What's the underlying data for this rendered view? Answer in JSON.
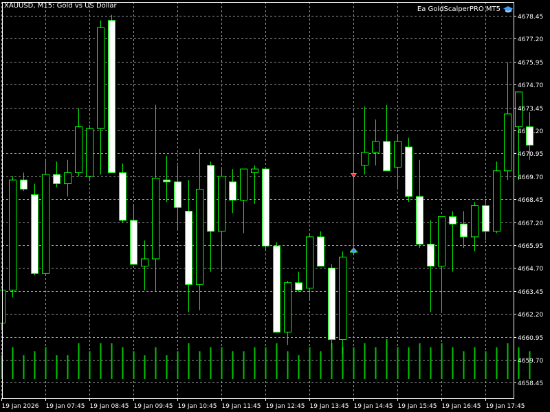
{
  "window": {
    "title": "XAUUSD, M15:  Gold vs US Dollar",
    "ea_label": "Ea GoldScalperPRO MT5",
    "ea_icon": "graduation-cap-icon"
  },
  "colors": {
    "background": "#000000",
    "grid": "#9a9a9a",
    "bull_fill": "#000000",
    "bear_fill": "#ffffff",
    "wick": "#00ff00",
    "volume": "#00c800",
    "axis_text": "#ffffff",
    "sell_marker": "#ff3030",
    "buy_marker": "#3aa0ff"
  },
  "chart_data": {
    "type": "candlestick",
    "y_axis": {
      "min": 4657.6,
      "max": 4679.2,
      "ticks": [
        "4678.45",
        "4677.20",
        "4675.95",
        "4674.70",
        "4673.45",
        "4672.20",
        "4670.95",
        "4669.70",
        "4668.45",
        "4667.20",
        "4665.95",
        "4664.70",
        "4663.45",
        "4662.20",
        "4660.95",
        "4659.70",
        "4658.45"
      ]
    },
    "x_axis": {
      "labels": [
        "19 Jan 2026",
        "19 Jan 07:45",
        "19 Jan 08:45",
        "19 Jan 09:45",
        "19 Jan 10:45",
        "19 Jan 11:45",
        "19 Jan 12:45",
        "19 Jan 13:45",
        "19 Jan 14:45",
        "19 Jan 15:45",
        "19 Jan 16:45",
        "19 Jan 17:45"
      ],
      "label_every": 4
    },
    "grid": true,
    "candles": [
      {
        "o": 4661.7,
        "h": 4663.5,
        "l": 4661.3,
        "c": 4663.5
      },
      {
        "o": 4663.5,
        "h": 4669.7,
        "l": 4663.1,
        "c": 4669.5
      },
      {
        "o": 4669.5,
        "h": 4669.9,
        "l": 4668.9,
        "c": 4669.0
      },
      {
        "o": 4668.7,
        "h": 4669.3,
        "l": 4664.3,
        "c": 4664.4
      },
      {
        "o": 4664.4,
        "h": 4670.6,
        "l": 4664.3,
        "c": 4669.8
      },
      {
        "o": 4669.8,
        "h": 4670.5,
        "l": 4669.1,
        "c": 4669.3
      },
      {
        "o": 4669.3,
        "h": 4670.6,
        "l": 4668.6,
        "c": 4669.9
      },
      {
        "o": 4669.9,
        "h": 4673.4,
        "l": 4669.7,
        "c": 4672.4
      },
      {
        "o": 4669.7,
        "h": 4672.5,
        "l": 4669.5,
        "c": 4672.3
      },
      {
        "o": 4672.3,
        "h": 4678.2,
        "l": 4669.8,
        "c": 4677.8
      },
      {
        "o": 4678.2,
        "h": 4678.5,
        "l": 4669.9,
        "c": 4669.9
      },
      {
        "o": 4669.9,
        "h": 4670.4,
        "l": 4667.2,
        "c": 4667.3
      },
      {
        "o": 4667.3,
        "h": 4668.2,
        "l": 4664.9,
        "c": 4664.9
      },
      {
        "o": 4664.8,
        "h": 4666.2,
        "l": 4663.5,
        "c": 4665.2
      },
      {
        "o": 4665.2,
        "h": 4673.6,
        "l": 4663.4,
        "c": 4669.6
      },
      {
        "o": 4669.5,
        "h": 4670.8,
        "l": 4668.3,
        "c": 4669.4
      },
      {
        "o": 4669.4,
        "h": 4670.3,
        "l": 4666.8,
        "c": 4668.0
      },
      {
        "o": 4667.8,
        "h": 4669.5,
        "l": 4662.3,
        "c": 4663.8
      },
      {
        "o": 4663.8,
        "h": 4671.2,
        "l": 4662.4,
        "c": 4669.0
      },
      {
        "o": 4670.3,
        "h": 4670.5,
        "l": 4664.5,
        "c": 4666.7
      },
      {
        "o": 4666.7,
        "h": 4670.1,
        "l": 4664.5,
        "c": 4669.7
      },
      {
        "o": 4669.4,
        "h": 4670.1,
        "l": 4667.7,
        "c": 4668.4
      },
      {
        "o": 4668.4,
        "h": 4669.7,
        "l": 4666.6,
        "c": 4670.1
      },
      {
        "o": 4669.9,
        "h": 4670.3,
        "l": 4668.2,
        "c": 4670.1
      },
      {
        "o": 4670.1,
        "h": 4670.1,
        "l": 4665.7,
        "c": 4665.9
      },
      {
        "o": 4665.9,
        "h": 4666.1,
        "l": 4661.6,
        "c": 4661.2
      },
      {
        "o": 4661.2,
        "h": 4664.0,
        "l": 4660.5,
        "c": 4663.9
      },
      {
        "o": 4663.9,
        "h": 4664.5,
        "l": 4663.4,
        "c": 4663.5
      },
      {
        "o": 4663.6,
        "h": 4666.6,
        "l": 4663.0,
        "c": 4666.4
      },
      {
        "o": 4666.4,
        "h": 4666.7,
        "l": 4664.8,
        "c": 4664.8
      },
      {
        "o": 4664.7,
        "h": 4664.9,
        "l": 4660.3,
        "c": 4660.8
      },
      {
        "o": 4660.8,
        "h": 4665.6,
        "l": 4660.0,
        "c": 4665.3
      },
      {
        "o": 4665.6,
        "h": 4672.8,
        "l": 4665.5,
        "c": 4665.6
      },
      {
        "o": 4670.3,
        "h": 4673.5,
        "l": 4669.8,
        "c": 4671.0
      },
      {
        "o": 4671.0,
        "h": 4672.8,
        "l": 4670.3,
        "c": 4671.6
      },
      {
        "o": 4671.6,
        "h": 4673.6,
        "l": 4670.3,
        "c": 4670.0
      },
      {
        "o": 4670.2,
        "h": 4672.0,
        "l": 4669.0,
        "c": 4671.6
      },
      {
        "o": 4671.3,
        "h": 4671.8,
        "l": 4668.3,
        "c": 4668.6
      },
      {
        "o": 4668.6,
        "h": 4670.6,
        "l": 4665.8,
        "c": 4666.0
      },
      {
        "o": 4666.0,
        "h": 4667.3,
        "l": 4662.3,
        "c": 4664.8
      },
      {
        "o": 4664.8,
        "h": 4666.5,
        "l": 4662.3,
        "c": 4667.5
      },
      {
        "o": 4667.5,
        "h": 4667.8,
        "l": 4664.5,
        "c": 4667.1
      },
      {
        "o": 4667.1,
        "h": 4667.8,
        "l": 4665.8,
        "c": 4666.4
      },
      {
        "o": 4666.4,
        "h": 4668.3,
        "l": 4665.6,
        "c": 4668.1
      },
      {
        "o": 4668.1,
        "h": 4668.3,
        "l": 4666.2,
        "c": 4666.7
      },
      {
        "o": 4666.7,
        "h": 4670.5,
        "l": 4666.6,
        "c": 4670.0
      },
      {
        "o": 4670.0,
        "h": 4675.9,
        "l": 4669.5,
        "c": 4673.1
      },
      {
        "o": 4672.4,
        "h": 4674.3,
        "l": 4669.5,
        "c": 4674.3
      },
      {
        "o": 4672.4,
        "h": 4673.2,
        "l": 4670.6,
        "c": 4671.4
      }
    ],
    "volumes": [
      0.6,
      0.8,
      0.6,
      0.7,
      0.8,
      0.6,
      0.6,
      0.9,
      0.7,
      0.9,
      0.9,
      0.8,
      0.7,
      0.6,
      0.8,
      0.6,
      0.7,
      0.9,
      0.7,
      0.8,
      0.8,
      0.7,
      0.7,
      0.8,
      0.8,
      0.9,
      0.7,
      0.6,
      0.8,
      0.7,
      0.9,
      0.8,
      0.8,
      0.9,
      0.8,
      1.0,
      0.8,
      0.8,
      0.9,
      0.8,
      0.9,
      0.8,
      0.7,
      0.8,
      0.7,
      0.8,
      0.9,
      0.8,
      0.7
    ],
    "trade": {
      "candle_index": 32,
      "entry_price": 4669.75,
      "exit_price": 4665.65
    }
  }
}
